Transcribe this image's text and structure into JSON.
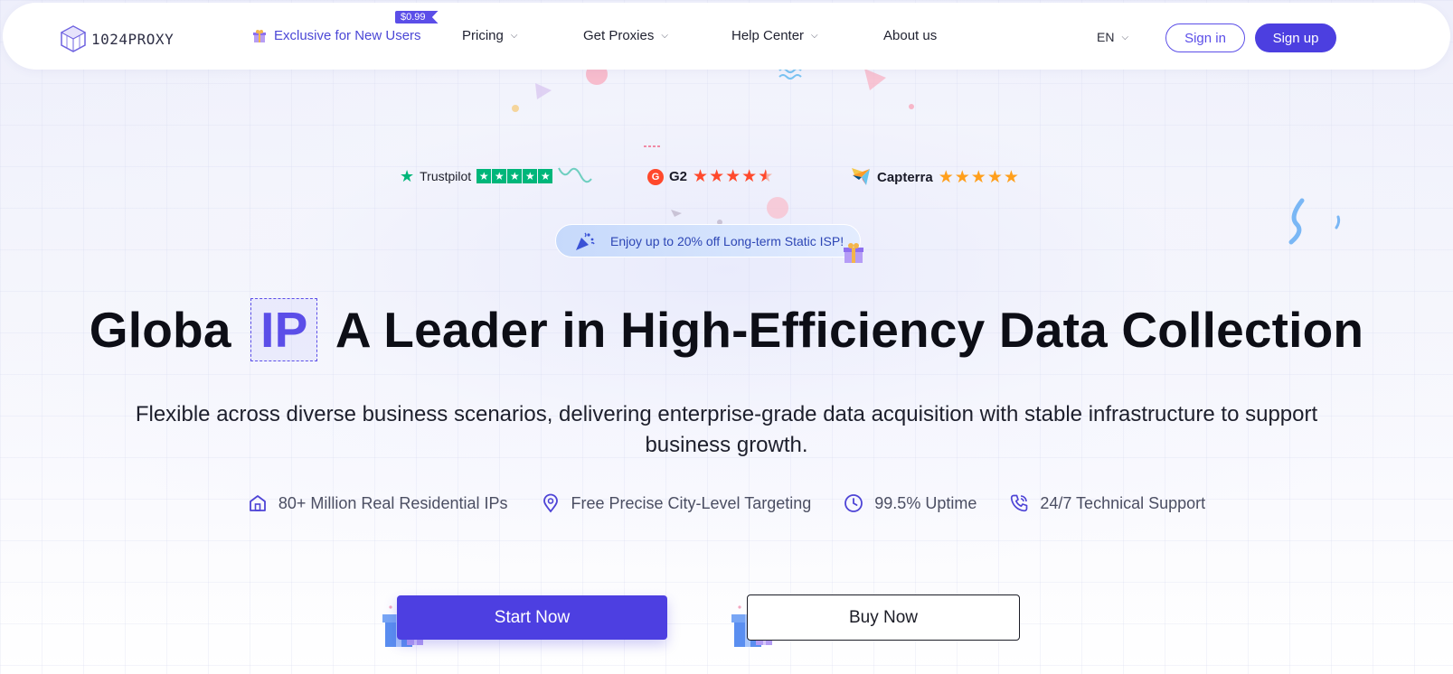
{
  "colors": {
    "brand": "#4c3fe0",
    "brand_text": "#5b4ee8",
    "trustpilot_green": "#00b67a",
    "g2_red": "#ff492c",
    "star_orange": "#ff9f1c"
  },
  "nav": {
    "logo_text": "1024PROXY",
    "logo_icon": "cube-logo-icon",
    "promo": {
      "label": "Exclusive for New Users",
      "tag": "$0.99",
      "icon": "gift-icon"
    },
    "items": [
      {
        "label": "Pricing",
        "has_dropdown": true
      },
      {
        "label": "Get Proxies",
        "has_dropdown": true
      },
      {
        "label": "Help Center",
        "has_dropdown": true
      },
      {
        "label": "About us",
        "has_dropdown": false
      }
    ],
    "language": "EN",
    "sign_in": "Sign in",
    "sign_up": "Sign up"
  },
  "ratings": {
    "trustpilot": {
      "name": "Trustpilot",
      "stars": 5
    },
    "g2": {
      "badge": "G",
      "name": "G2",
      "stars": 4.5
    },
    "capterra": {
      "name": "Capterra",
      "stars": 5
    }
  },
  "promo_banner": {
    "text": "Enjoy up to 20% off Long-term Static ISP!"
  },
  "hero": {
    "title_prefix": "Globa",
    "title_highlight": "IP",
    "title_suffix": "A Leader in High-Efficiency Data Collection",
    "subtitle": "Flexible across diverse business scenarios, delivering enterprise-grade data acquisition with stable infrastructure to support business growth."
  },
  "features": [
    {
      "icon": "home-icon",
      "label": "80+ Million Real Residential IPs"
    },
    {
      "icon": "location-pin-icon",
      "label": "Free Precise City-Level Targeting"
    },
    {
      "icon": "clock-icon",
      "label": "99.5% Uptime"
    },
    {
      "icon": "phone-icon",
      "label": "24/7 Technical Support"
    }
  ],
  "cta": {
    "primary": "Start Now",
    "secondary": "Buy Now"
  }
}
